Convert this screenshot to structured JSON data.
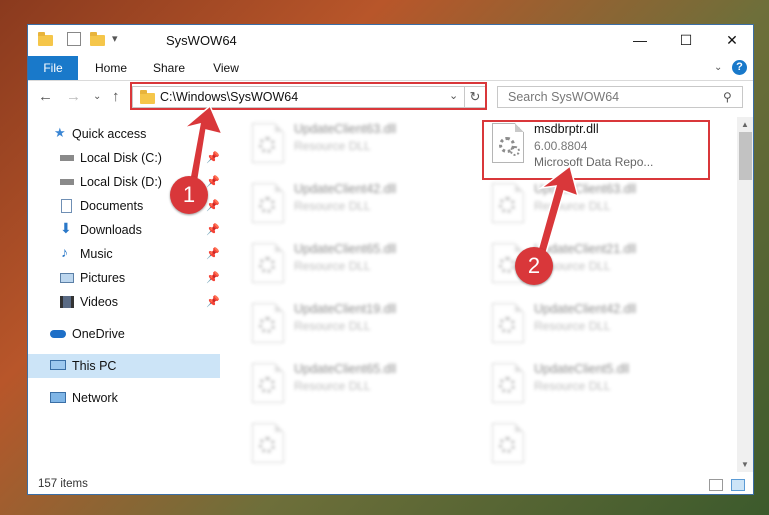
{
  "window": {
    "title": "SysWOW64",
    "minimize_glyph": "—",
    "maximize_glyph": "☐",
    "close_glyph": "✕"
  },
  "ribbon": {
    "tabs": [
      "File",
      "Home",
      "Share",
      "View"
    ],
    "help_glyph": "?"
  },
  "navbar": {
    "address": "C:\\Windows\\SysWOW64",
    "search_placeholder": "Search SysWOW64"
  },
  "sidebar": {
    "items": [
      {
        "label": "Quick access",
        "icon": "star-icon"
      },
      {
        "label": "Local Disk (C:)",
        "icon": "drive-icon"
      },
      {
        "label": "Local Disk (D:)",
        "icon": "drive-icon"
      },
      {
        "label": "Documents",
        "icon": "documents-icon"
      },
      {
        "label": "Downloads",
        "icon": "download-icon"
      },
      {
        "label": "Music",
        "icon": "music-icon"
      },
      {
        "label": "Pictures",
        "icon": "pictures-icon"
      },
      {
        "label": "Videos",
        "icon": "videos-icon"
      },
      {
        "label": "OneDrive",
        "icon": "cloud-icon"
      },
      {
        "label": "This PC",
        "icon": "computer-icon"
      },
      {
        "label": "Network",
        "icon": "network-icon"
      }
    ]
  },
  "files": {
    "highlighted": {
      "name": "msdbrptr.dll",
      "version": "6.00.8804",
      "description": "Microsoft Data Repo..."
    },
    "left_column": [
      {
        "name": "UpdateClient63.dll",
        "type": "Resource DLL"
      },
      {
        "name": "UpdateClient42.dll",
        "type": "Resource DLL"
      },
      {
        "name": "UpdateClient65.dll",
        "type": "Resource DLL"
      },
      {
        "name": "UpdateClient19.dll",
        "type": "Resource DLL"
      },
      {
        "name": "UpdateClient65.dll",
        "type": "Resource DLL"
      },
      {
        "name": "",
        "type": ""
      }
    ],
    "right_column": [
      {
        "name": "UpdateClient63.dll",
        "type": "Resource DLL"
      },
      {
        "name": "UpdateClient21.dll",
        "type": "Resource DLL"
      },
      {
        "name": "UpdateClient42.dll",
        "type": "Resource DLL"
      },
      {
        "name": "UpdateClient5.dll",
        "type": "Resource DLL"
      },
      {
        "name": "",
        "type": ""
      }
    ]
  },
  "status": {
    "item_count": "157 items"
  },
  "annotations": {
    "step1": "1",
    "step2": "2",
    "color": "#d9373a"
  }
}
